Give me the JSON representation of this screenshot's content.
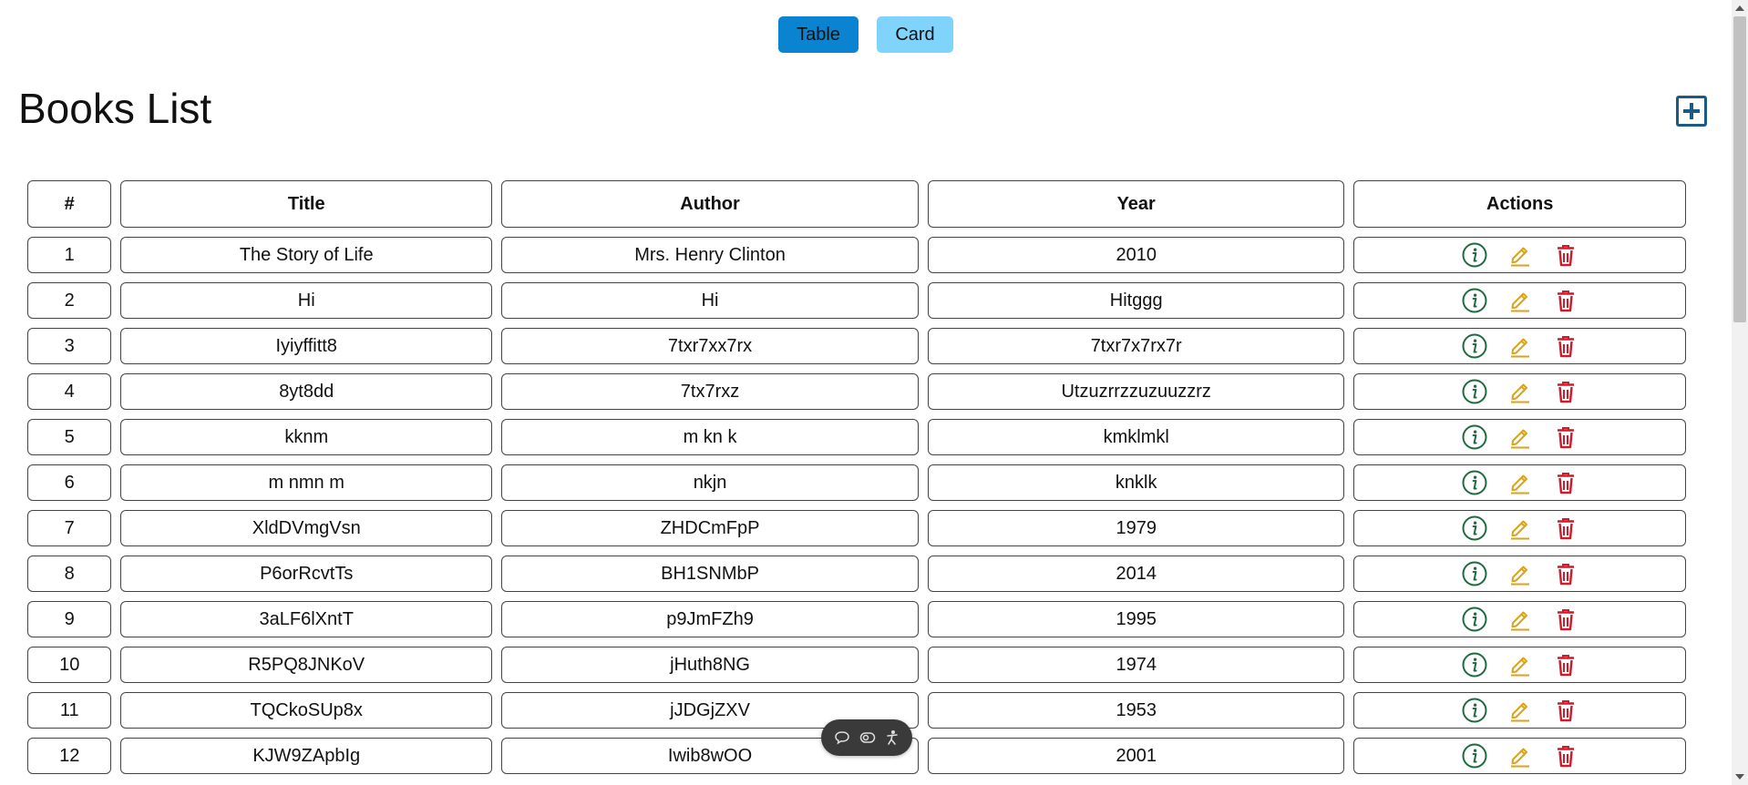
{
  "view_toggle": {
    "table_label": "Table",
    "card_label": "Card"
  },
  "page": {
    "title": "Books List"
  },
  "colors": {
    "table_btn": "#0a84d0",
    "card_btn": "#80d4fb",
    "info": "#1e6b3d",
    "edit": "#d9a31a",
    "delete": "#d11a2a",
    "add": "#1c5a86"
  },
  "table": {
    "headers": [
      "#",
      "Title",
      "Author",
      "Year",
      "Actions"
    ],
    "rows": [
      {
        "num": "1",
        "title": "The Story of Life",
        "author": "Mrs. Henry Clinton",
        "year": "2010"
      },
      {
        "num": "2",
        "title": "Hi",
        "author": "Hi",
        "year": "Hitggg"
      },
      {
        "num": "3",
        "title": "Iyiyffitt8",
        "author": "7txr7xx7rx",
        "year": "7txr7x7rx7r"
      },
      {
        "num": "4",
        "title": "8yt8dd",
        "author": "7tx7rxz",
        "year": "Utzuzrrzzuzuuzzrz"
      },
      {
        "num": "5",
        "title": "kknm",
        "author": "m kn k",
        "year": "kmklmkl"
      },
      {
        "num": "6",
        "title": "m nmn m",
        "author": "nkjn",
        "year": "knklk"
      },
      {
        "num": "7",
        "title": "XldDVmgVsn",
        "author": "ZHDCmFpP",
        "year": "1979"
      },
      {
        "num": "8",
        "title": "P6orRcvtTs",
        "author": "BH1SNMbP",
        "year": "2014"
      },
      {
        "num": "9",
        "title": "3aLF6lXntT",
        "author": "p9JmFZh9",
        "year": "1995"
      },
      {
        "num": "10",
        "title": "R5PQ8JNKoV",
        "author": "jHuth8NG",
        "year": "1974"
      },
      {
        "num": "11",
        "title": "TQCkoSUp8x",
        "author": "jJDGjZXV",
        "year": "1953"
      },
      {
        "num": "12",
        "title": "KJW9ZApbIg",
        "author": "Iwib8wOO",
        "year": "2001"
      }
    ]
  },
  "icons": {
    "add": "plus-square-icon",
    "info": "info-circle-icon",
    "edit": "pencil-icon",
    "delete": "trash-icon"
  }
}
